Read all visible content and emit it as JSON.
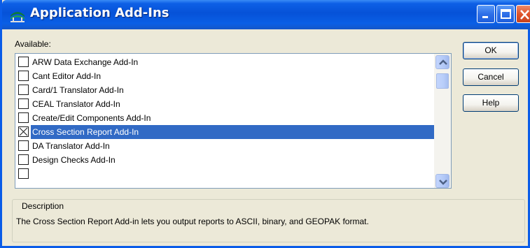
{
  "window": {
    "title": "Application Add-Ins",
    "icon": "app-logo-icon",
    "controls": [
      "minimize-icon",
      "maximize-icon",
      "close-icon"
    ]
  },
  "available": {
    "label": "Available:",
    "items": [
      {
        "label": "ARW Data Exchange Add-In",
        "checked": false,
        "selected": false
      },
      {
        "label": "Cant Editor Add-In",
        "checked": false,
        "selected": false
      },
      {
        "label": "Card/1 Translator Add-In",
        "checked": false,
        "selected": false
      },
      {
        "label": "CEAL Translator Add-In",
        "checked": false,
        "selected": false
      },
      {
        "label": "Create/Edit Components Add-In",
        "checked": false,
        "selected": false
      },
      {
        "label": "Cross Section Report Add-In",
        "checked": true,
        "selected": true
      },
      {
        "label": "DA Translator Add-In",
        "checked": false,
        "selected": false
      },
      {
        "label": "Design Checks Add-In",
        "checked": false,
        "selected": false
      }
    ]
  },
  "buttons": {
    "ok": "OK",
    "cancel": "Cancel",
    "help": "Help"
  },
  "description": {
    "legend": "Description",
    "text": "The Cross Section Report Add-in lets you output reports to ASCII, binary, and GEOPAK format."
  },
  "colors": {
    "title_bar": "#0652D8",
    "selection": "#316AC5",
    "dialog_bg": "#ECE9D8",
    "close_button": "#E0542B"
  }
}
